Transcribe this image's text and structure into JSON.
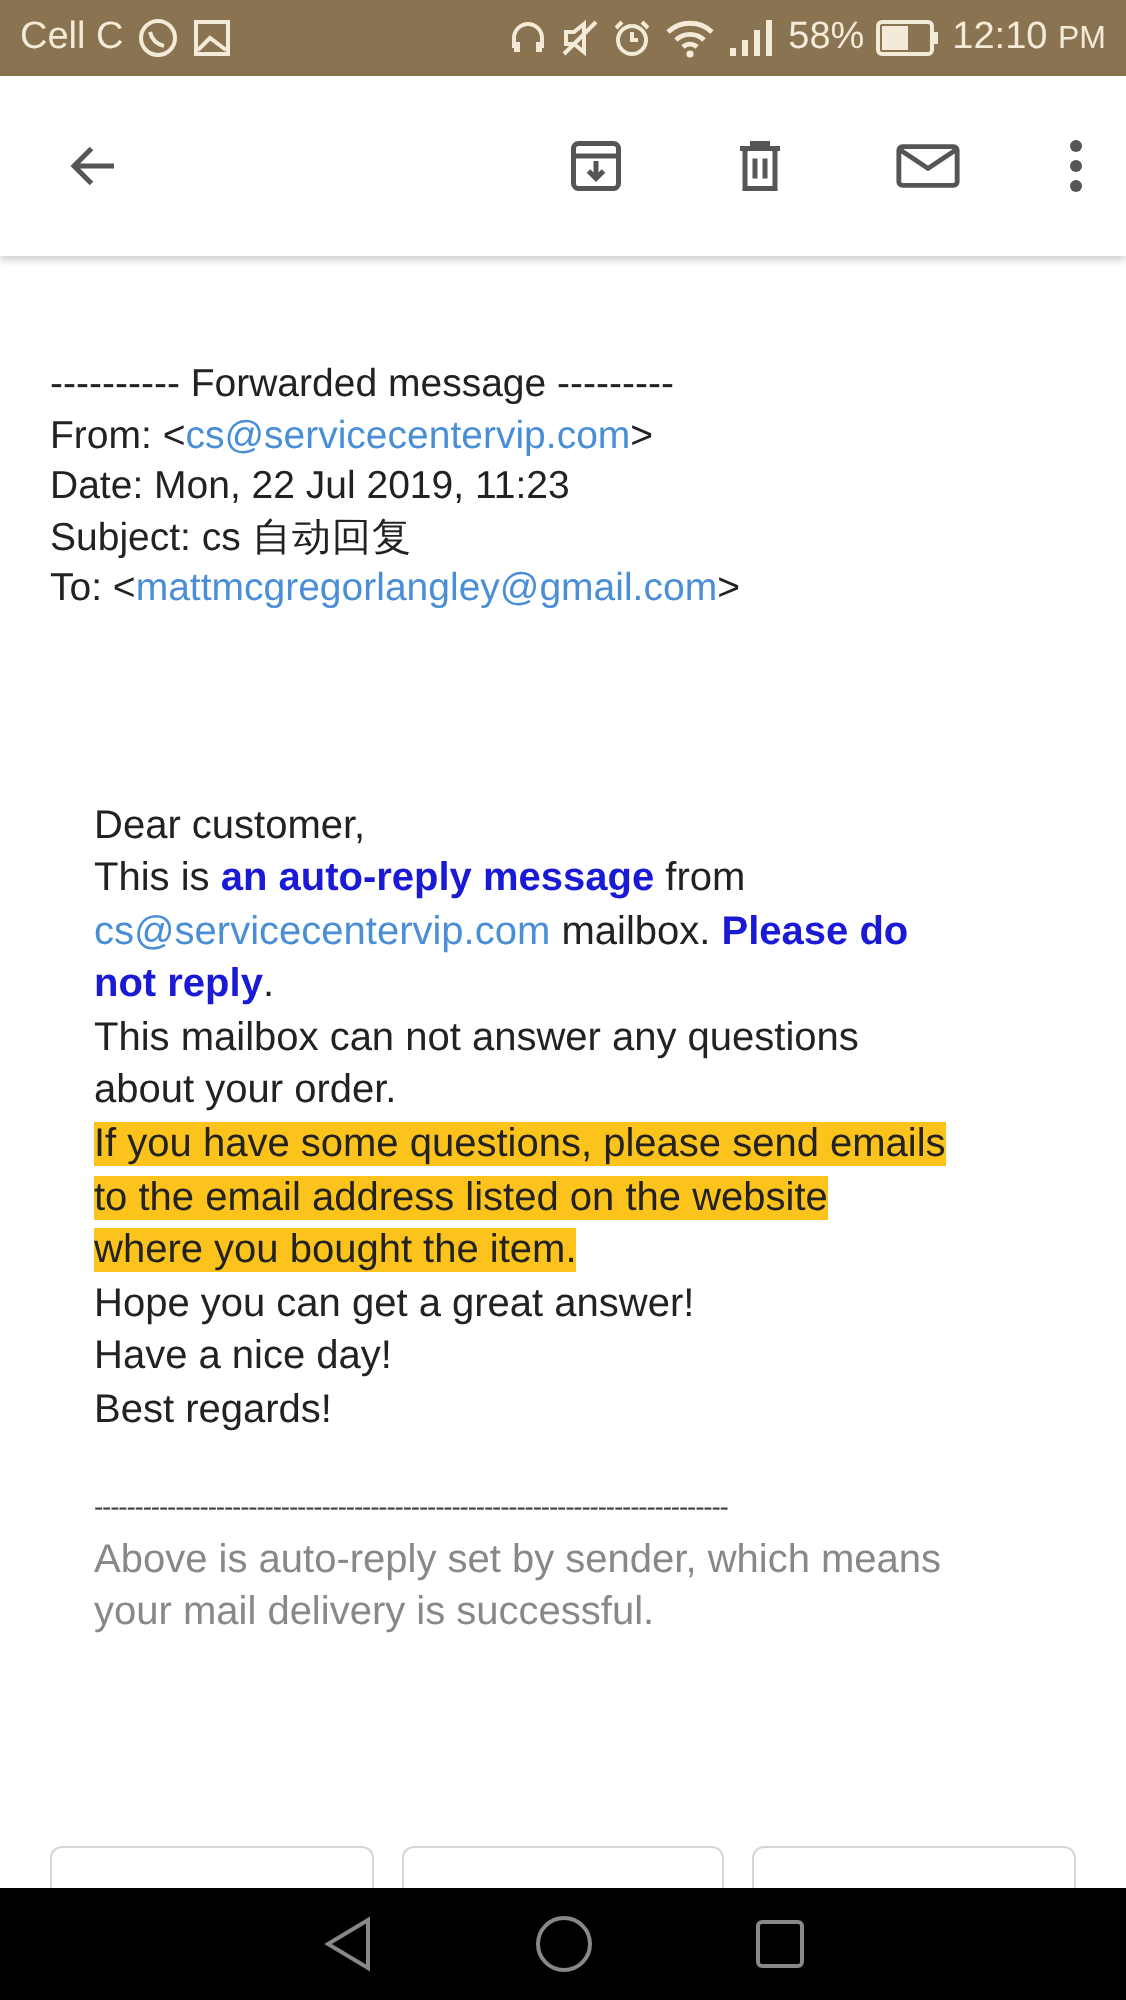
{
  "status_bar": {
    "carrier": "Cell C",
    "battery_text": "58%",
    "time": "12:10",
    "time_suffix": "PM"
  },
  "header": [
    {
      "kind": "plain",
      "parts": [
        {
          "kind": "text",
          "text": "---------- Forwarded message ---------"
        }
      ]
    },
    {
      "kind": "plain",
      "parts": [
        {
          "kind": "text",
          "text": "From: <"
        },
        {
          "kind": "link",
          "text": "cs@servicecentervip.com"
        },
        {
          "kind": "text",
          "text": ">"
        }
      ]
    },
    {
      "kind": "plain",
      "parts": [
        {
          "kind": "text",
          "text": "Date: Mon, 22 Jul 2019, 11:23"
        }
      ]
    },
    {
      "kind": "plain",
      "parts": [
        {
          "kind": "text",
          "text": "Subject: cs 自动回复"
        }
      ]
    },
    {
      "kind": "plain",
      "parts": [
        {
          "kind": "text",
          "text": "To: <"
        },
        {
          "kind": "link",
          "text": "mattmcgregorlangley@gmail.com"
        },
        {
          "kind": "text",
          "text": ">"
        }
      ]
    }
  ],
  "body": [
    {
      "kind": "plain",
      "parts": [
        {
          "kind": "text",
          "text": "Dear customer,"
        }
      ]
    },
    {
      "kind": "plain",
      "parts": [
        {
          "kind": "text",
          "text": "This is "
        },
        {
          "kind": "strong",
          "text": "an auto-reply message"
        },
        {
          "kind": "text",
          "text": " from"
        }
      ]
    },
    {
      "kind": "plain",
      "parts": [
        {
          "kind": "link",
          "text": "cs@servicecentervip.com"
        },
        {
          "kind": "text",
          "text": " mailbox. "
        },
        {
          "kind": "strong",
          "text": "Please do"
        }
      ]
    },
    {
      "kind": "plain",
      "parts": [
        {
          "kind": "strong",
          "text": "not reply"
        },
        {
          "kind": "text",
          "text": "."
        }
      ]
    },
    {
      "kind": "plain",
      "parts": [
        {
          "kind": "text",
          "text": "This mailbox can not answer any questions"
        }
      ]
    },
    {
      "kind": "plain",
      "parts": [
        {
          "kind": "text",
          "text": "about your order."
        }
      ]
    },
    {
      "kind": "highlight",
      "parts": [
        {
          "kind": "text",
          "text": "If you have some questions, please send emails"
        }
      ]
    },
    {
      "kind": "highlight",
      "parts": [
        {
          "kind": "text",
          "text": "to the email address listed on the website"
        }
      ]
    },
    {
      "kind": "highlight",
      "parts": [
        {
          "kind": "text",
          "text": "where you bought the item."
        }
      ]
    },
    {
      "kind": "plain",
      "parts": [
        {
          "kind": "text",
          "text": "Hope you can get a great answer!"
        }
      ]
    },
    {
      "kind": "plain",
      "parts": [
        {
          "kind": "text",
          "text": "Have a nice day!"
        }
      ]
    },
    {
      "kind": "plain",
      "parts": [
        {
          "kind": "text",
          "text": "Best regards!"
        }
      ]
    }
  ],
  "separator": "------------------------------------------------------------------------------",
  "footer_note": "Above is auto-reply set by sender, which means your mail delivery is successful."
}
